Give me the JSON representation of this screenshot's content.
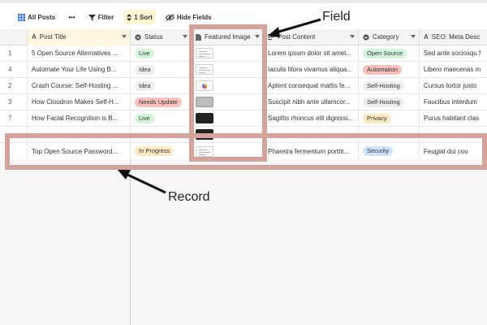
{
  "toolbar": {
    "view_label": "All Posts",
    "more_label": "•••",
    "filter_label": "Filter",
    "sort_label": "1 Sort",
    "hide_fields_label": "Hide Fields",
    "view_icon": "grid-icon",
    "filter_icon": "filter-icon",
    "sort_icon": "sort-icon",
    "hide_icon": "eye-slash-icon"
  },
  "columns": {
    "post_title": "Post Title",
    "status": "Status",
    "featured_image": "Featured Image",
    "post_content": "Post Content",
    "category": "Category",
    "seo_meta": "SEO: Meta Desc"
  },
  "rows": [
    {
      "num": "1",
      "title": "5 Open Source Alternatives ...",
      "status": "Live",
      "image": "doc",
      "content": "Lorem ipsum dolor sit amet...",
      "category": "Open Source",
      "seo": "Sed ante sociosqu f"
    },
    {
      "num": "4",
      "title": "Automate Your Life Using B...",
      "status": "Idea",
      "image": "doc",
      "content": "Iaculis litora vivamus aliqua...",
      "category": "Automation",
      "seo": "Libero maecenas m"
    },
    {
      "num": "2",
      "title": "Crash Course: Self-Hosting ...",
      "status": "Idea",
      "image": "logo",
      "content": "Aptent consequat mattis fe...",
      "category": "Self-Hosting",
      "seo": "Cursus tortor justo"
    },
    {
      "num": "3",
      "title": "How Cloudron Makes Self-H...",
      "status": "Needs Update",
      "image": "photo",
      "content": "Suscipit nibh ante ullamcor...",
      "category": "Self-Hosting",
      "seo": "Faucibus interdum"
    },
    {
      "num": "7",
      "title": "How Facial Recognition is B...",
      "status": "Live",
      "image": "dark",
      "content": "Sagittis rhoncus elit dignissi...",
      "category": "Privacy",
      "seo": "Purus habitant clas"
    },
    {
      "num": "",
      "title": "",
      "status": "",
      "image": "dark",
      "content": "",
      "category": "",
      "seo": ""
    }
  ],
  "record": {
    "title": "Top Open Source Password...",
    "status": "In Progress",
    "image": "doc",
    "content": "Pharetra fermentum porttit...",
    "category": "Security",
    "seo": "Feugiat dui cou"
  },
  "status_colors": {
    "Live": "#d3f5dc",
    "Idea": "#eeeeee",
    "Needs Update": "#f7c2bb",
    "In Progress": "#fde9c4"
  },
  "category_colors": {
    "Open Source": "#d3f5dc",
    "Automation": "#f7c2bb",
    "Self-Hosting": "#eeeeee",
    "Privacy": "#fde9c4",
    "Security": "#cfe2fa"
  },
  "annotations": {
    "field_label": "Field",
    "record_label": "Record",
    "highlight_color": "#d4a39b"
  }
}
